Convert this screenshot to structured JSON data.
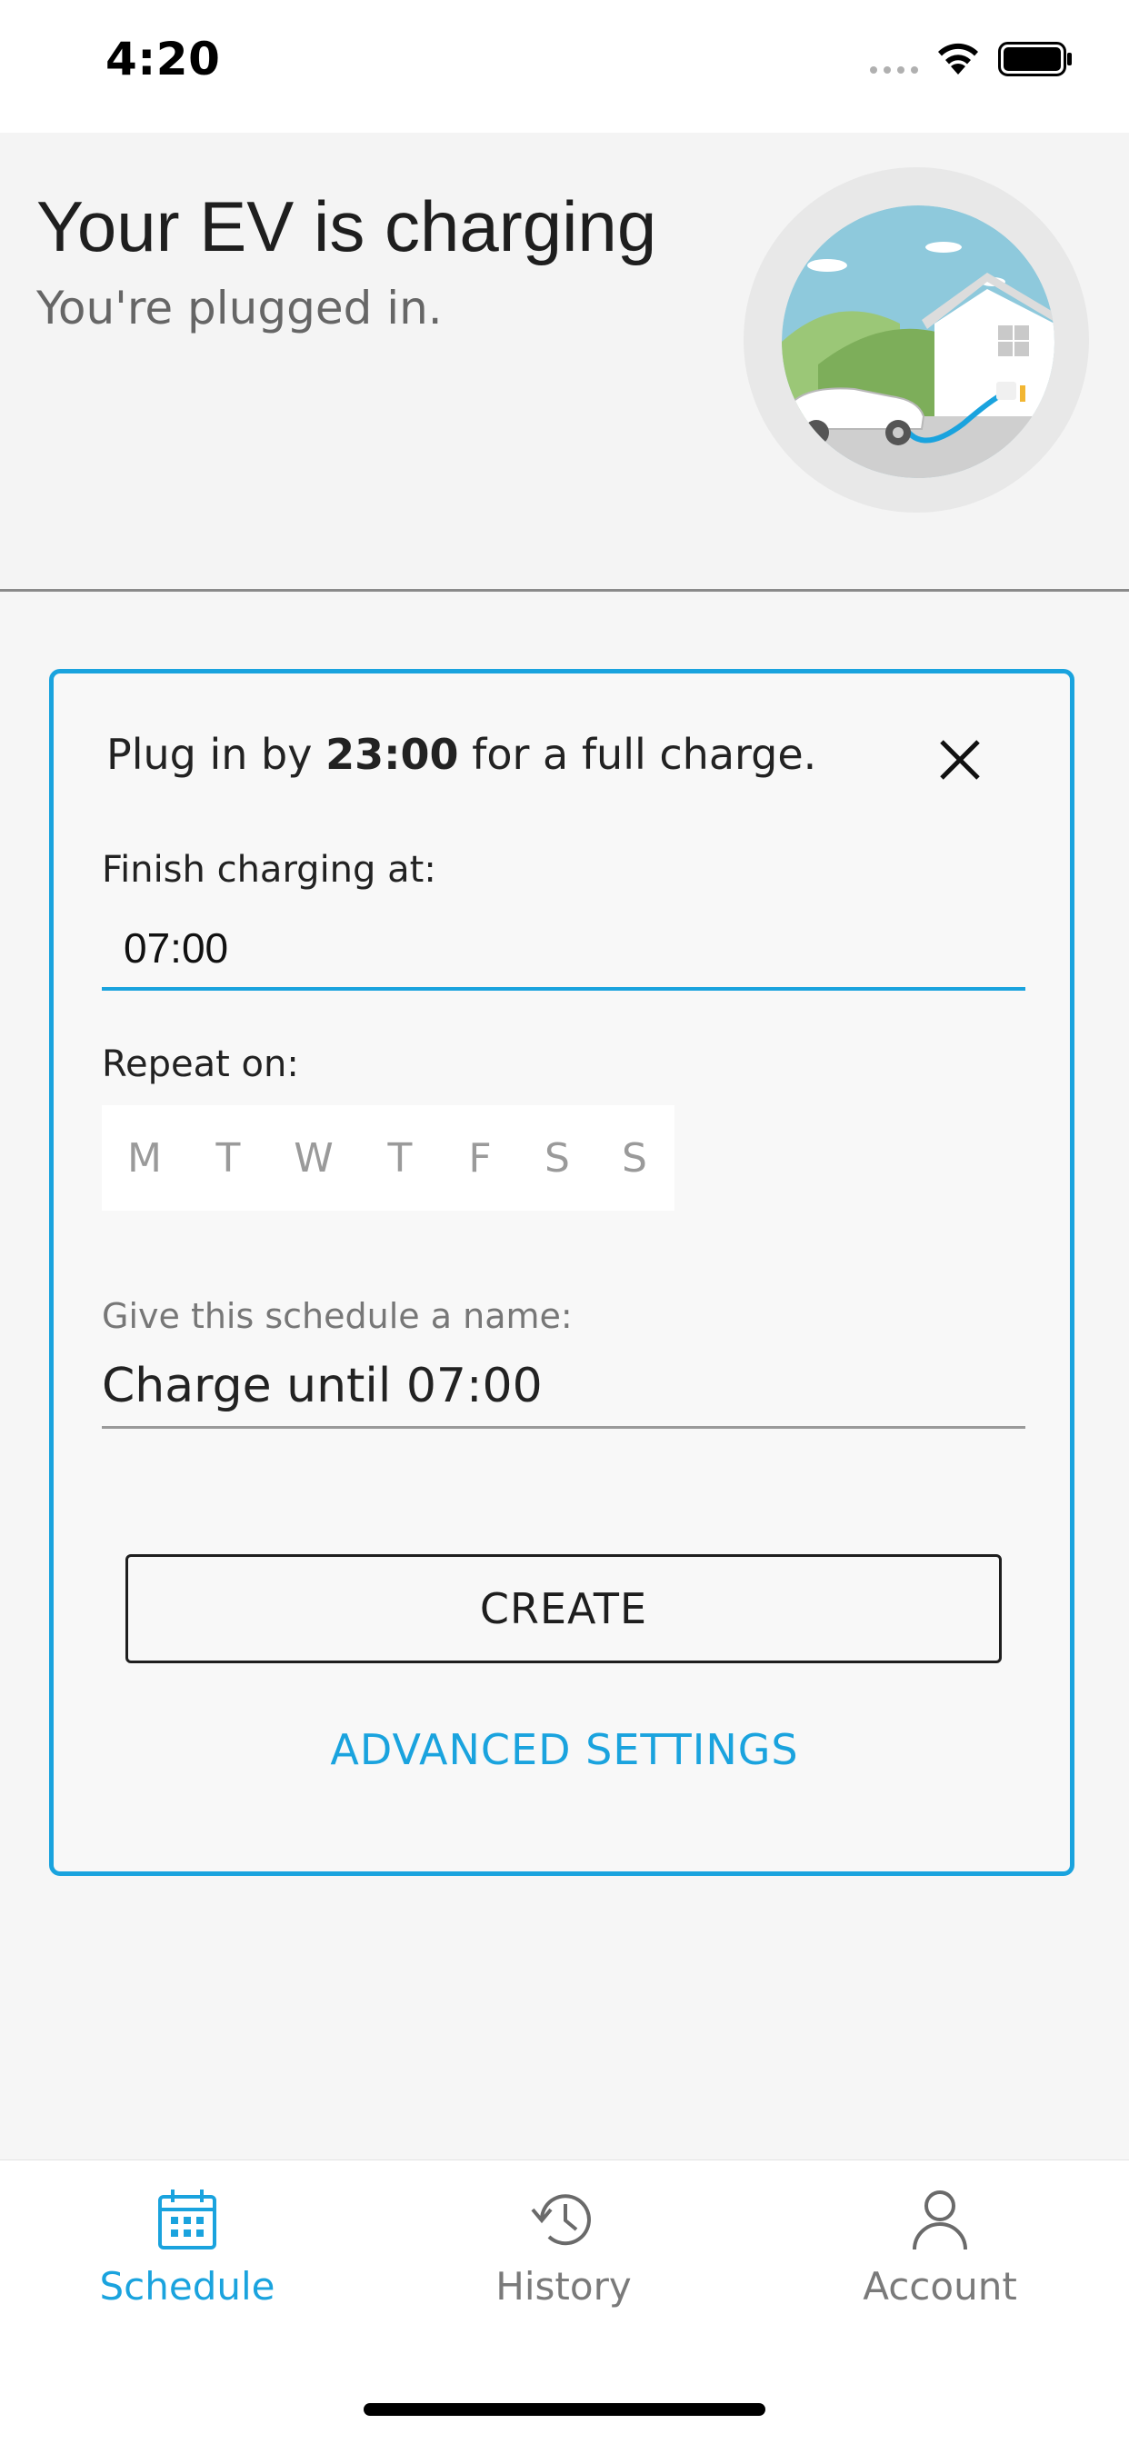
{
  "status_bar": {
    "time": "4:20",
    "icons": [
      "signal-dots-icon",
      "wifi-icon",
      "battery-icon"
    ]
  },
  "header": {
    "title": "Your EV is charging",
    "subtitle": "You're plugged in.",
    "illustration": "ev-charging-at-home-illustration"
  },
  "card": {
    "plug_prefix": "Plug in by ",
    "plug_time": "23:00",
    "plug_suffix": " for a full charge.",
    "close_icon": "close-icon",
    "finish_label": "Finish charging at:",
    "finish_value": "07:00",
    "repeat_label": "Repeat on:",
    "days": [
      "M",
      "T",
      "W",
      "T",
      "F",
      "S",
      "S"
    ],
    "name_label": "Give this schedule a name:",
    "name_value": "Charge until 07:00",
    "create_label": "CREATE",
    "advanced_label": "ADVANCED SETTINGS"
  },
  "bottom_nav": {
    "items": [
      {
        "label": "Schedule",
        "icon": "calendar-icon",
        "active": true
      },
      {
        "label": "History",
        "icon": "history-icon",
        "active": false
      },
      {
        "label": "Account",
        "icon": "user-icon",
        "active": false
      }
    ]
  },
  "colors": {
    "accent": "#1aa3de",
    "text": "#1e1e1e",
    "muted": "#9a9a9a"
  }
}
